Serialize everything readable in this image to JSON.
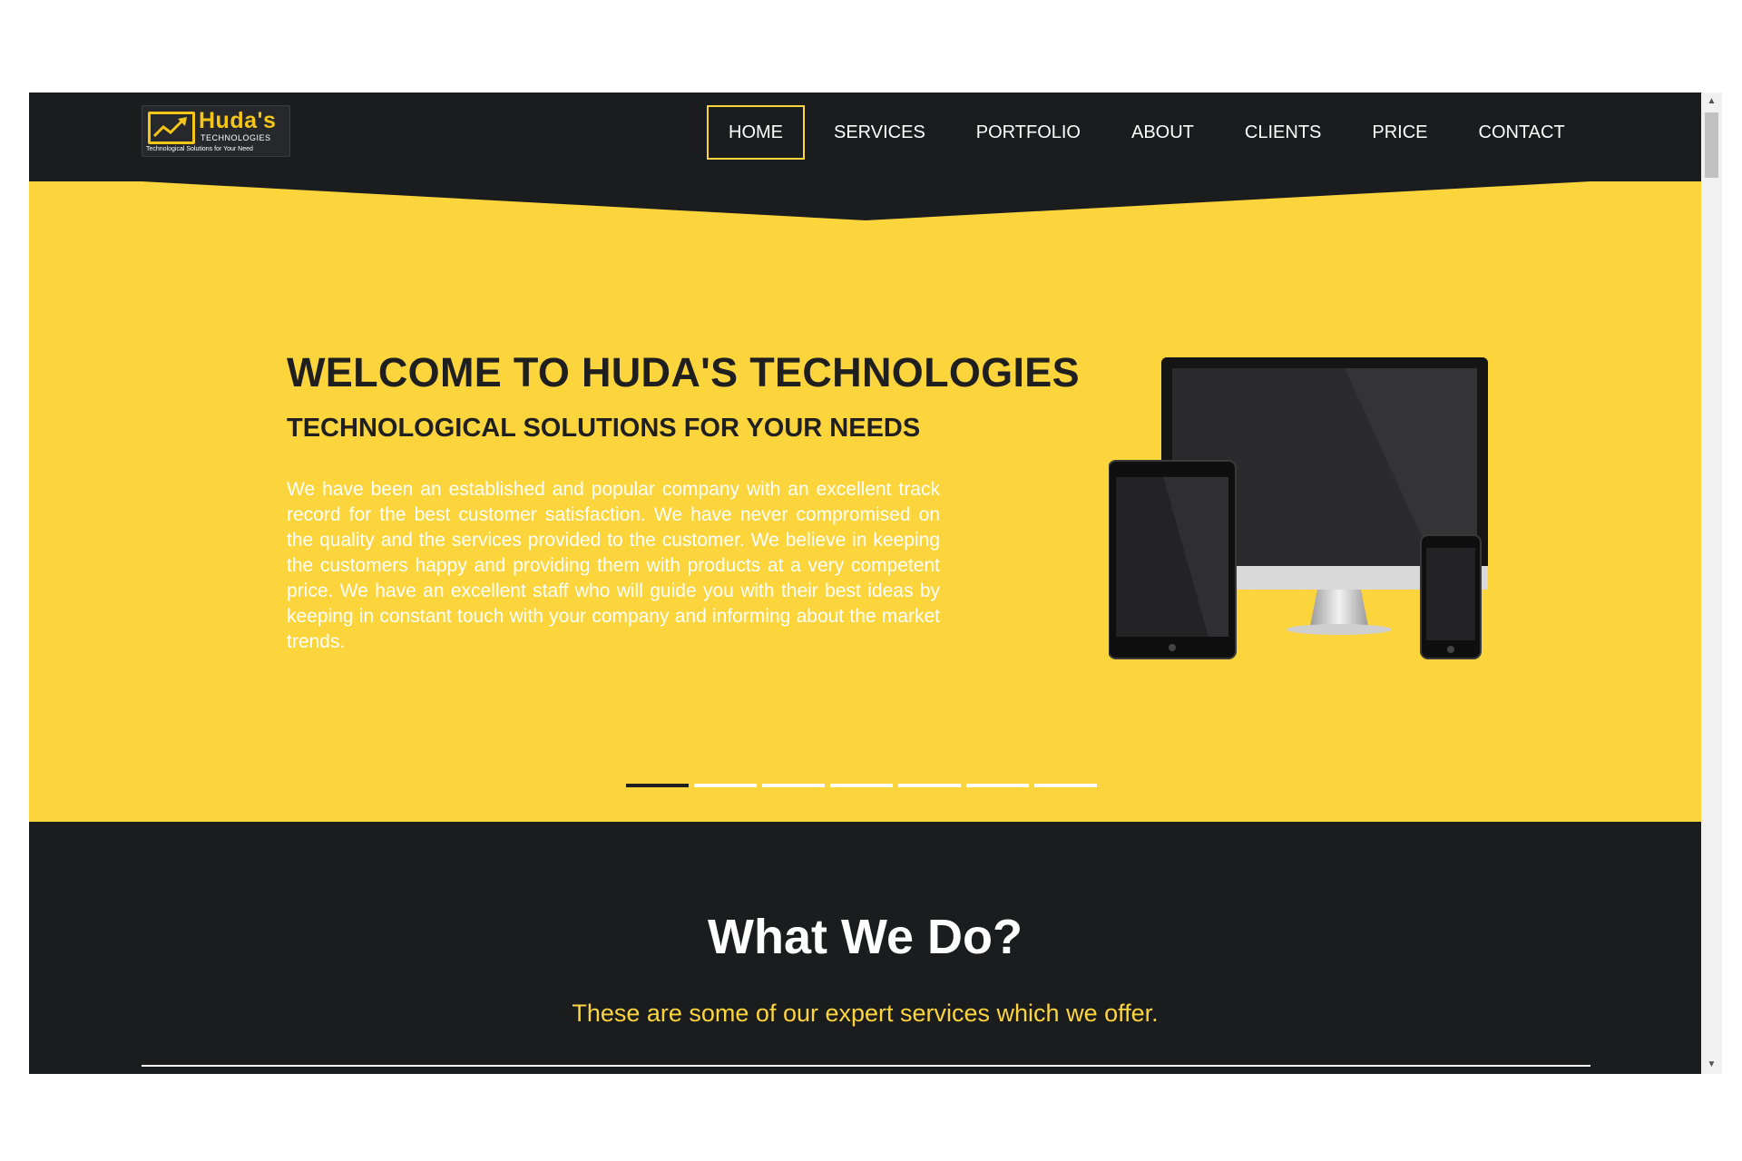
{
  "logo": {
    "brand": "Huda's",
    "sub": "TECHNOLOGIES",
    "tagline": "Technological Solutions for Your Need"
  },
  "nav": {
    "items": [
      {
        "label": "HOME",
        "active": true
      },
      {
        "label": "SERVICES"
      },
      {
        "label": "PORTFOLIO"
      },
      {
        "label": "ABOUT"
      },
      {
        "label": "CLIENTS"
      },
      {
        "label": "PRICE"
      },
      {
        "label": "CONTACT"
      }
    ]
  },
  "hero": {
    "title": "WELCOME TO HUDA'S TECHNOLOGIES",
    "subtitle": "TECHNOLOGICAL SOLUTIONS FOR YOUR NEEDS",
    "body": "We have been an established and popular company with an excellent track record for the best customer satisfaction. We have never compromised on the quality and the services provided to the customer. We believe in keeping the customers happy and providing them with products at a very competent price. We have an excellent staff who will guide you with their best ideas by keeping in constant touch with your company and informing about the market trends.",
    "slides_total": 7,
    "active_slide": 1
  },
  "services": {
    "title": "What We Do?",
    "subtitle": "These are some of our expert services which we offer."
  },
  "colors": {
    "accent": "#fcd53c",
    "dark": "#1b1c1e"
  },
  "icons": {
    "logo": "chart-up-icon",
    "scroll_up": "chevron-up-icon",
    "scroll_down": "chevron-down-icon"
  }
}
